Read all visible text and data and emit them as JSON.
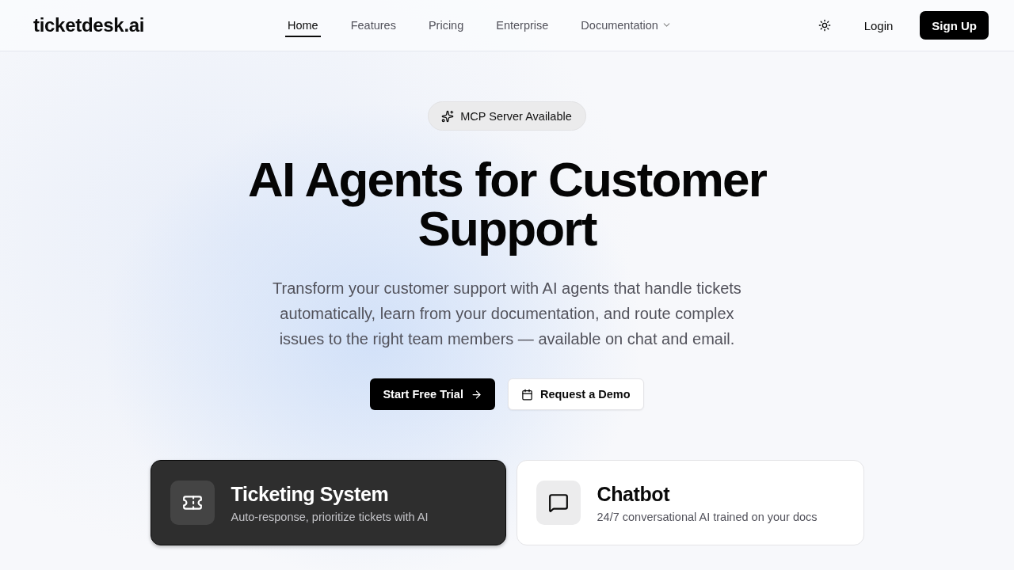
{
  "header": {
    "logo": "ticketdesk.ai",
    "nav": [
      {
        "label": "Home",
        "selected": true,
        "kind": "link"
      },
      {
        "label": "Features",
        "selected": false,
        "kind": "link"
      },
      {
        "label": "Pricing",
        "selected": false,
        "kind": "link"
      },
      {
        "label": "Enterprise",
        "selected": false,
        "kind": "link"
      },
      {
        "label": "Documentation",
        "selected": false,
        "kind": "dropdown"
      }
    ],
    "login": "Login",
    "signup": "Sign Up"
  },
  "hero": {
    "badge": "MCP Server Available",
    "title": "AI Agents for Customer Support",
    "subtitle": "Transform your customer support with AI agents that handle tickets automatically, learn from your documentation, and route complex issues to the right team members — available on chat and email.",
    "primary_button": "Start Free Trial",
    "secondary_button": "Request a Demo"
  },
  "products": [
    {
      "title": "Ticketing System",
      "description": "Auto-response, prioritize tickets with AI",
      "selected": true,
      "kind": "ticket"
    },
    {
      "title": "Chatbot",
      "description": "24/7 conversational AI trained on your docs",
      "selected": false,
      "kind": "chat"
    }
  ]
}
